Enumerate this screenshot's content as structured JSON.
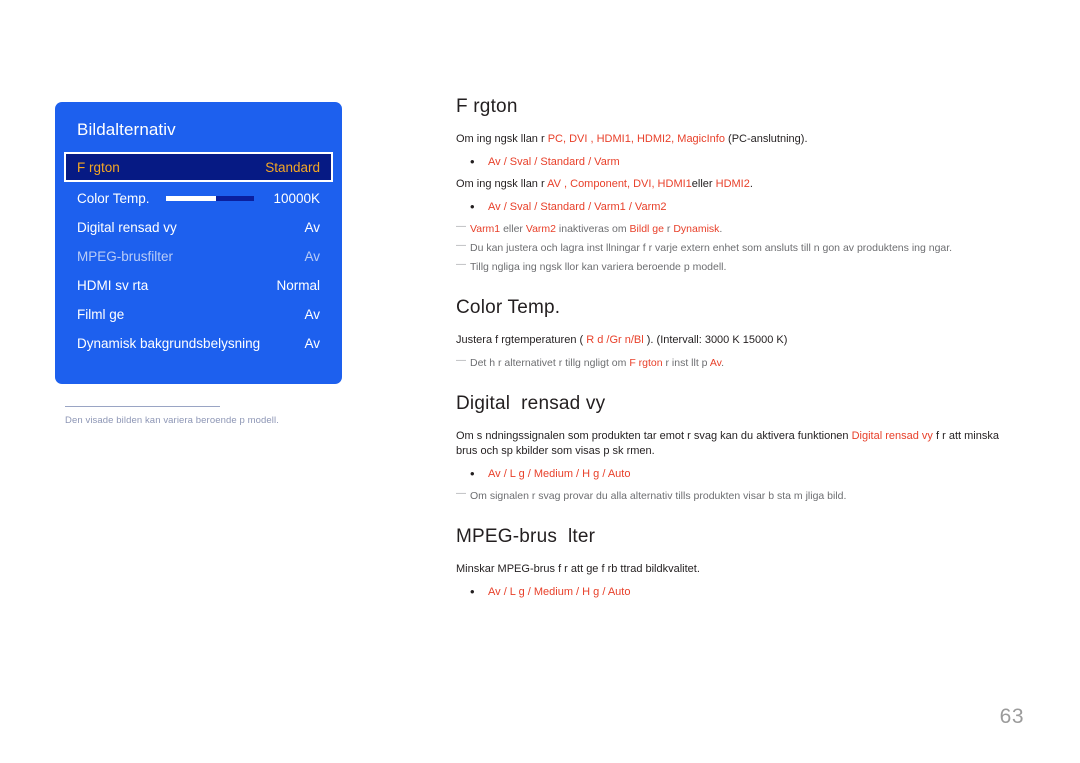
{
  "osd": {
    "title": "Bildalternativ",
    "rows": [
      {
        "label": "F rgton",
        "value": "Standard",
        "type": "selected"
      },
      {
        "label": "Color Temp.",
        "value": "10000K",
        "type": "slider",
        "slider_fill_percent": 56
      },
      {
        "label": "Digital rensad vy",
        "value": "Av",
        "type": "normal"
      },
      {
        "label": "MPEG-brusfilter",
        "value": "Av",
        "type": "dim"
      },
      {
        "label": "HDMI sv rta",
        "value": "Normal",
        "type": "normal"
      },
      {
        "label": "Filml ge",
        "value": "Av",
        "type": "normal"
      },
      {
        "label": "Dynamisk bakgrundsbelysning",
        "value": "Av",
        "type": "normal"
      }
    ],
    "caption": "Den visade bilden kan variera beroende p  modell."
  },
  "sections": {
    "fargton": {
      "heading": "F rgton",
      "intro_1": {
        "pre": "Om ing ngsk llan  r ",
        "hl": "PC, DVI , HDMI1, HDMI2, MagicInfo",
        "post": " (PC-anslutning)."
      },
      "options_1": "Av / Sval / Standard / Varm",
      "intro_2": {
        "pre": "Om ing ngsk llan  r ",
        "hl": "AV  , Component, DVI, HDMI1",
        "mid": "eller ",
        "hl2": "HDMI2",
        "post": "."
      },
      "options_2": "Av / Sval / Standard / Varm1 / Varm2",
      "note_1": {
        "hl_a": "Varm1 ",
        "t_a": "eller ",
        "hl_b": "Varm2 ",
        "t_b": "inaktiveras om ",
        "hl_c": "Bildl ge",
        "t_c": "  r   ",
        "hl_d": "Dynamisk",
        "t_d": "."
      },
      "note_2": "Du kan justera och lagra inst llningar f r varje extern enhet som ansluts till n gon av produktens ing ngar.",
      "note_3": "Tillg ngliga ing ngsk llor kan variera beroende p  modell."
    },
    "color_temp": {
      "heading": "Color Temp.",
      "intro": {
        "pre": "Justera f rgtemperaturen (  ",
        "hl": "R d /Gr n/Bl",
        "post": "   ). (Intervall: 3000 K 15000 K)"
      },
      "note": {
        "t_a": "Det h r alternativet  r tillg ngligt om ",
        "hl_a": "F rgton",
        "t_b": "        r inst llt p    ",
        "hl_b": "Av",
        "t_c": "."
      }
    },
    "digital_clean_view": {
      "heading": "Digital  rensad vy",
      "intro": {
        "pre": "Om s ndningssignalen som produkten tar emot  r svag kan du aktivera funktionen  ",
        "hl": "Digital rensad vy",
        "post": " f r att minska brus och sp kbilder som visas p  sk rmen."
      },
      "options": "Av / L g / Medium / H g / Auto",
      "note": "Om signalen  r svag provar du alla alternativ tills produkten visar b sta m jliga bild."
    },
    "mpeg_noise_filter": {
      "heading": "MPEG-brus  lter",
      "intro": "Minskar MPEG-brus f r att ge f rb ttrad bildkvalitet.",
      "options": "Av / L g / Medium / H g / Auto"
    }
  },
  "page": {
    "number": "63"
  },
  "colors": {
    "osd_panel_blue": "#1d60ee",
    "osd_selected_bg": "#061a84",
    "osd_selected_text": "#f5a623",
    "accent_red": "#e8402a",
    "note_gray": "#6d6e71",
    "caption_gray": "#8d96b5",
    "page_number_gray": "#9b9b9b"
  }
}
